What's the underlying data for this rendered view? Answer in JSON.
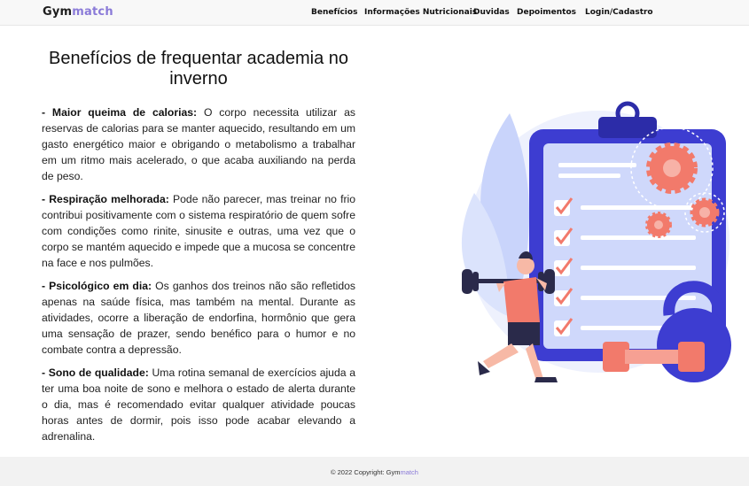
{
  "brand": {
    "part1": "Gym",
    "part2": "match",
    "accent_color": "#8a7ad8"
  },
  "nav": {
    "beneficios": "Benefícios",
    "info": "Informações Nutricionais",
    "duvidas": "Duvidas",
    "depoimentos": "Depoimentos",
    "login": "Login/Cadastro"
  },
  "main": {
    "title": "Benefícios de frequentar academia no inverno",
    "items": [
      {
        "heading": "- Maior queima de calorias:",
        "text": " O corpo necessita utilizar as reservas de calorias para se manter aquecido, resultando em um gasto energético maior e obrigando o metabolismo a trabalhar em um ritmo mais acelerado, o que acaba auxiliando na perda de peso."
      },
      {
        "heading": "- Respiração melhorada:",
        "text": " Pode não parecer, mas treinar no frio contribui positivamente com o sistema respiratório de quem sofre com condições como rinite, sinusite e outras, uma vez que o corpo se mantém aquecido e impede que a mucosa se concentre na face e nos pulmões."
      },
      {
        "heading": "- Psicológico em dia:",
        "text": " Os ganhos dos treinos não são refletidos apenas na saúde física, mas também na mental. Durante as atividades, ocorre a liberação de endorfina, hormônio que gera uma sensação de prazer, sendo benéfico para o humor e no combate contra a depressão."
      },
      {
        "heading": "- Sono de qualidade:",
        "text": " Uma rotina semanal de exercícios ajuda a ter uma boa noite de sono e melhora o estado de alerta durante o dia, mas é recomendado evitar qualquer atividade poucas horas antes de dormir, pois isso pode acabar elevando a adrenalina."
      }
    ]
  },
  "footer": {
    "copyright": "© 2022 Copyright: Gym",
    "brand_highlight": "match"
  },
  "colors": {
    "navy": "#3d3dd1",
    "coral": "#f27a6b",
    "light_blue": "#c9d4fb"
  }
}
